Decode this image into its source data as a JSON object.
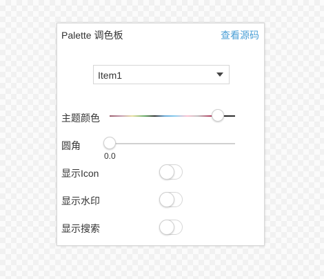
{
  "panel": {
    "title": "Palette 调色板",
    "source_link": "查看源码"
  },
  "select": {
    "value": "Item1"
  },
  "theme_color": {
    "label": "主题颜色",
    "value_fraction": 0.86
  },
  "corner_radius": {
    "label": "圆角",
    "value": "0.0",
    "value_fraction": 0.0
  },
  "toggles": [
    {
      "label": "显示Icon",
      "on": false
    },
    {
      "label": "显示水印",
      "on": false
    },
    {
      "label": "显示搜索",
      "on": false
    }
  ],
  "colors": {
    "link": "#4b9fd6",
    "text": "#333333"
  }
}
